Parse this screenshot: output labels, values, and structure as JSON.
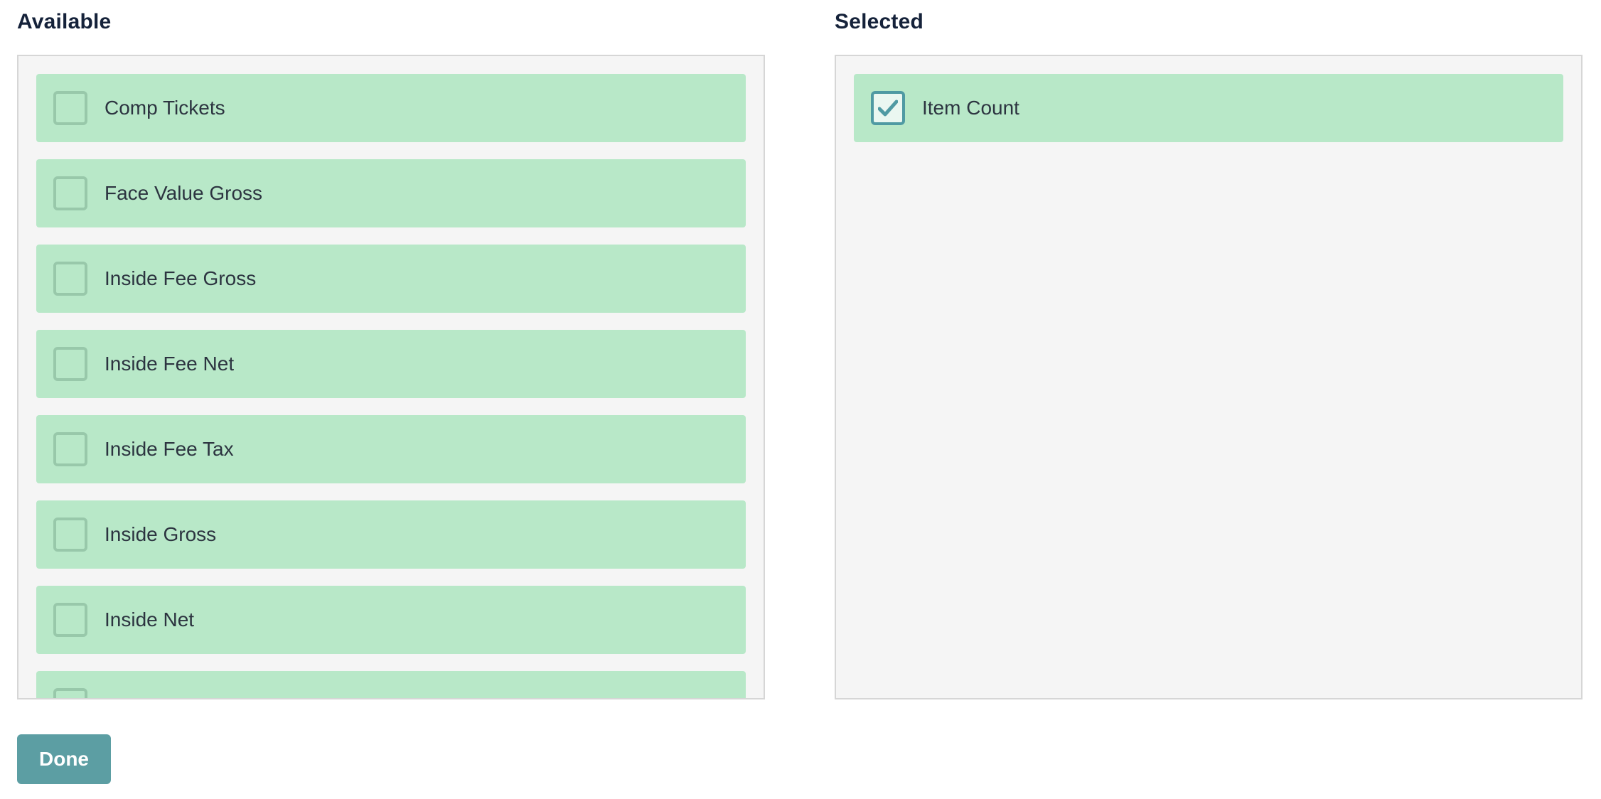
{
  "available": {
    "title": "Available",
    "items": [
      {
        "label": "Comp Tickets",
        "checked": false
      },
      {
        "label": "Face Value Gross",
        "checked": false
      },
      {
        "label": "Inside Fee Gross",
        "checked": false
      },
      {
        "label": "Inside Fee Net",
        "checked": false
      },
      {
        "label": "Inside Fee Tax",
        "checked": false
      },
      {
        "label": "Inside Gross",
        "checked": false
      },
      {
        "label": "Inside Net",
        "checked": false
      },
      {
        "label": "",
        "checked": false
      }
    ]
  },
  "selected": {
    "title": "Selected",
    "items": [
      {
        "label": "Item Count",
        "checked": true
      }
    ]
  },
  "footer": {
    "done_label": "Done"
  },
  "colors": {
    "item_bg": "#b8e8c8",
    "checkbox_border": "#98c8aa",
    "checkbox_checked_border": "#4f9aa3",
    "accent": "#5c9ea3",
    "panel_bg": "#f5f5f5"
  },
  "icons": {
    "checked_mark": "checkmark-icon"
  }
}
